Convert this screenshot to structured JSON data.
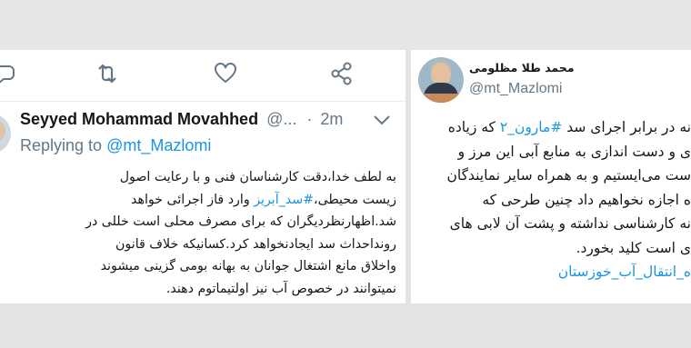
{
  "left_tweet": {
    "actions": [
      "reply-icon",
      "retweet-icon",
      "like-icon",
      "share-icon"
    ],
    "author_name": "Seyyed Mohammad Movahhed",
    "author_handle": "@...",
    "separator": "·",
    "time": "2m",
    "replying_prefix": "Replying to",
    "replying_to": "@mt_Mazlomi",
    "text": {
      "line1": "به لطف خدا،دقت کارشناسان فنی و با رعایت اصول",
      "line2_before": "زیست محیطی،",
      "line2_hashtag": "#سد_آبریز",
      "line2_after": " وارد فاز اجرائی خواهد",
      "line3": "شد.اظهارنظردیگران که برای مصرف محلی است خللی در",
      "line4": "رونداحداث سد ایجادنخواهد کرد.کسانیکه خلاف قانون",
      "line5": "واخلاق مانع اشتغال جوانان به بهانه بومی گزینی میشوند",
      "line6": "نمیتوانند در خصوص آب نیز اولتیماتوم دهند."
    },
    "colors": {
      "link": "#1b95e0",
      "muted": "#657786",
      "text": "#14171a"
    }
  },
  "right_tweet": {
    "display_name": "محمد طلا مظلومی",
    "handle": "@mt_Mazlomi",
    "text": {
      "line1_before": "نه در برابر اجرای سد ",
      "line1_hashtag": "#مارون_۲",
      "line1_after": " که زیاده",
      "line2": "ی و دست اندازی به منابع آبی این مرز و",
      "line3": "ست می‌ایستیم و به همراه سایر نمایندگان",
      "line4": "ه اجازه نخواهیم داد چنین طرحی که",
      "line5": "نه کارشناسی نداشته و پشت آن لابی های",
      "line6": "ی است کلید بخورد.",
      "line7_hashtag": "ه_انتقال_آب_خوزستان"
    }
  }
}
